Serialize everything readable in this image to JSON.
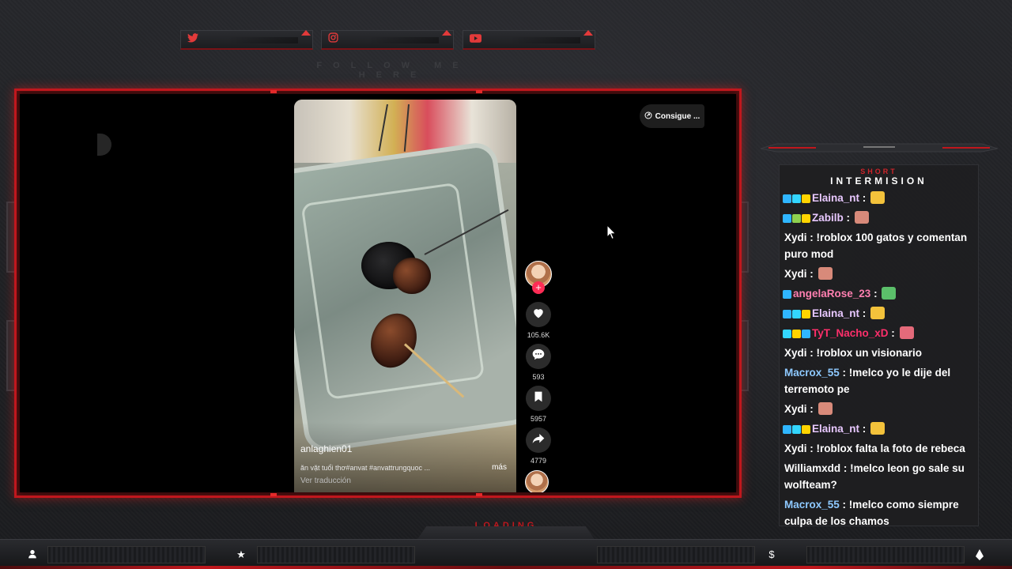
{
  "social": {
    "items": [
      {
        "icon": "twitter-icon"
      },
      {
        "icon": "instagram-icon"
      },
      {
        "icon": "youtube-icon"
      }
    ],
    "follow_text": "FOLLOW ME HERE"
  },
  "colors": {
    "accent_red": "#c0171d",
    "tiktok_pink": "#fe2c55",
    "chat_yellow_name": "#ffffff",
    "name_blue": "#8ec9ff",
    "name_pink": "#ff6fa8",
    "name_magenta": "#ff2f6b",
    "name_lavender": "#d9b8ff"
  },
  "video": {
    "consigue_label": "Consigue ...",
    "author": "anlaghien01",
    "caption": "ăn vặt tuổi thơ#anvat #anvattrungquoc ...",
    "more_label": "más",
    "translate_label": "Ver traducción",
    "likes": "105.6K",
    "comments": "593",
    "saves": "5957",
    "shares": "4779"
  },
  "chat": {
    "short_label": "SHORT",
    "title": "INTERMISION",
    "messages": [
      {
        "user": "Elaina_nt",
        "sep": " : ",
        "text": "",
        "color": "#e8c8ff",
        "badges": [
          "#2fb6ff",
          "#33d6ff",
          "#ffd400"
        ],
        "emote": "#f3c23b"
      },
      {
        "user": "Zabilb",
        "sep": " : ",
        "text": "",
        "color": "#e8c8ff",
        "badges": [
          "#2fb6ff",
          "#8fd14f",
          "#ffd400"
        ],
        "emote": "#d88a7a"
      },
      {
        "user": "Xydi",
        "sep": " : ",
        "text": "!roblox 100 gatos y comentan puro mod",
        "color": "#ffffff",
        "badges": [],
        "emote": ""
      },
      {
        "user": "Xydi",
        "sep": " : ",
        "text": "",
        "color": "#ffffff",
        "badges": [],
        "emote": "#d88a7a"
      },
      {
        "user": "angelaRose_23",
        "sep": " : ",
        "text": "",
        "color": "#ff7fb0",
        "badges": [
          "#2fb6ff"
        ],
        "emote": "#5bbf6a"
      },
      {
        "user": "Elaina_nt",
        "sep": " : ",
        "text": "",
        "color": "#e8c8ff",
        "badges": [
          "#2fb6ff",
          "#33d6ff",
          "#ffd400"
        ],
        "emote": "#f3c23b"
      },
      {
        "user": "TyT_Nacho_xD",
        "sep": " : ",
        "text": "",
        "color": "#ff2f6b",
        "badges": [
          "#33d6ff",
          "#ffd400",
          "#2fb6ff"
        ],
        "emote": "#e46a7a"
      },
      {
        "user": "Xydi",
        "sep": " : ",
        "text": "!roblox un visionario",
        "color": "#ffffff",
        "badges": [],
        "emote": ""
      },
      {
        "user": "Macrox_55",
        "sep": " : ",
        "text": "!melco yo le dije del terremoto pe",
        "color": "#8ec9ff",
        "badges": [],
        "emote": ""
      },
      {
        "user": "Xydi",
        "sep": " : ",
        "text": "",
        "color": "#ffffff",
        "badges": [],
        "emote": "#d88a7a"
      },
      {
        "user": "Elaina_nt",
        "sep": " : ",
        "text": "",
        "color": "#e8c8ff",
        "badges": [
          "#2fb6ff",
          "#33d6ff",
          "#ffd400"
        ],
        "emote": "#f3c23b"
      },
      {
        "user": "Xydi",
        "sep": " : ",
        "text": "!roblox falta la foto de rebeca",
        "color": "#ffffff",
        "badges": [],
        "emote": ""
      },
      {
        "user": "Williamxdd",
        "sep": " : ",
        "text": "!melco leon go sale su wolfteam?",
        "color": "#ffffff",
        "badges": [],
        "emote": ""
      },
      {
        "user": "Macrox_55",
        "sep": " : ",
        "text": "!melco como siempre culpa de los chamos",
        "color": "#8ec9ff",
        "badges": [],
        "emote": ""
      }
    ]
  },
  "bottom": {
    "loading_label": "LOADING",
    "icons": [
      "user-icon",
      "star-icon",
      "dollar-icon",
      "diamond-icon"
    ]
  }
}
